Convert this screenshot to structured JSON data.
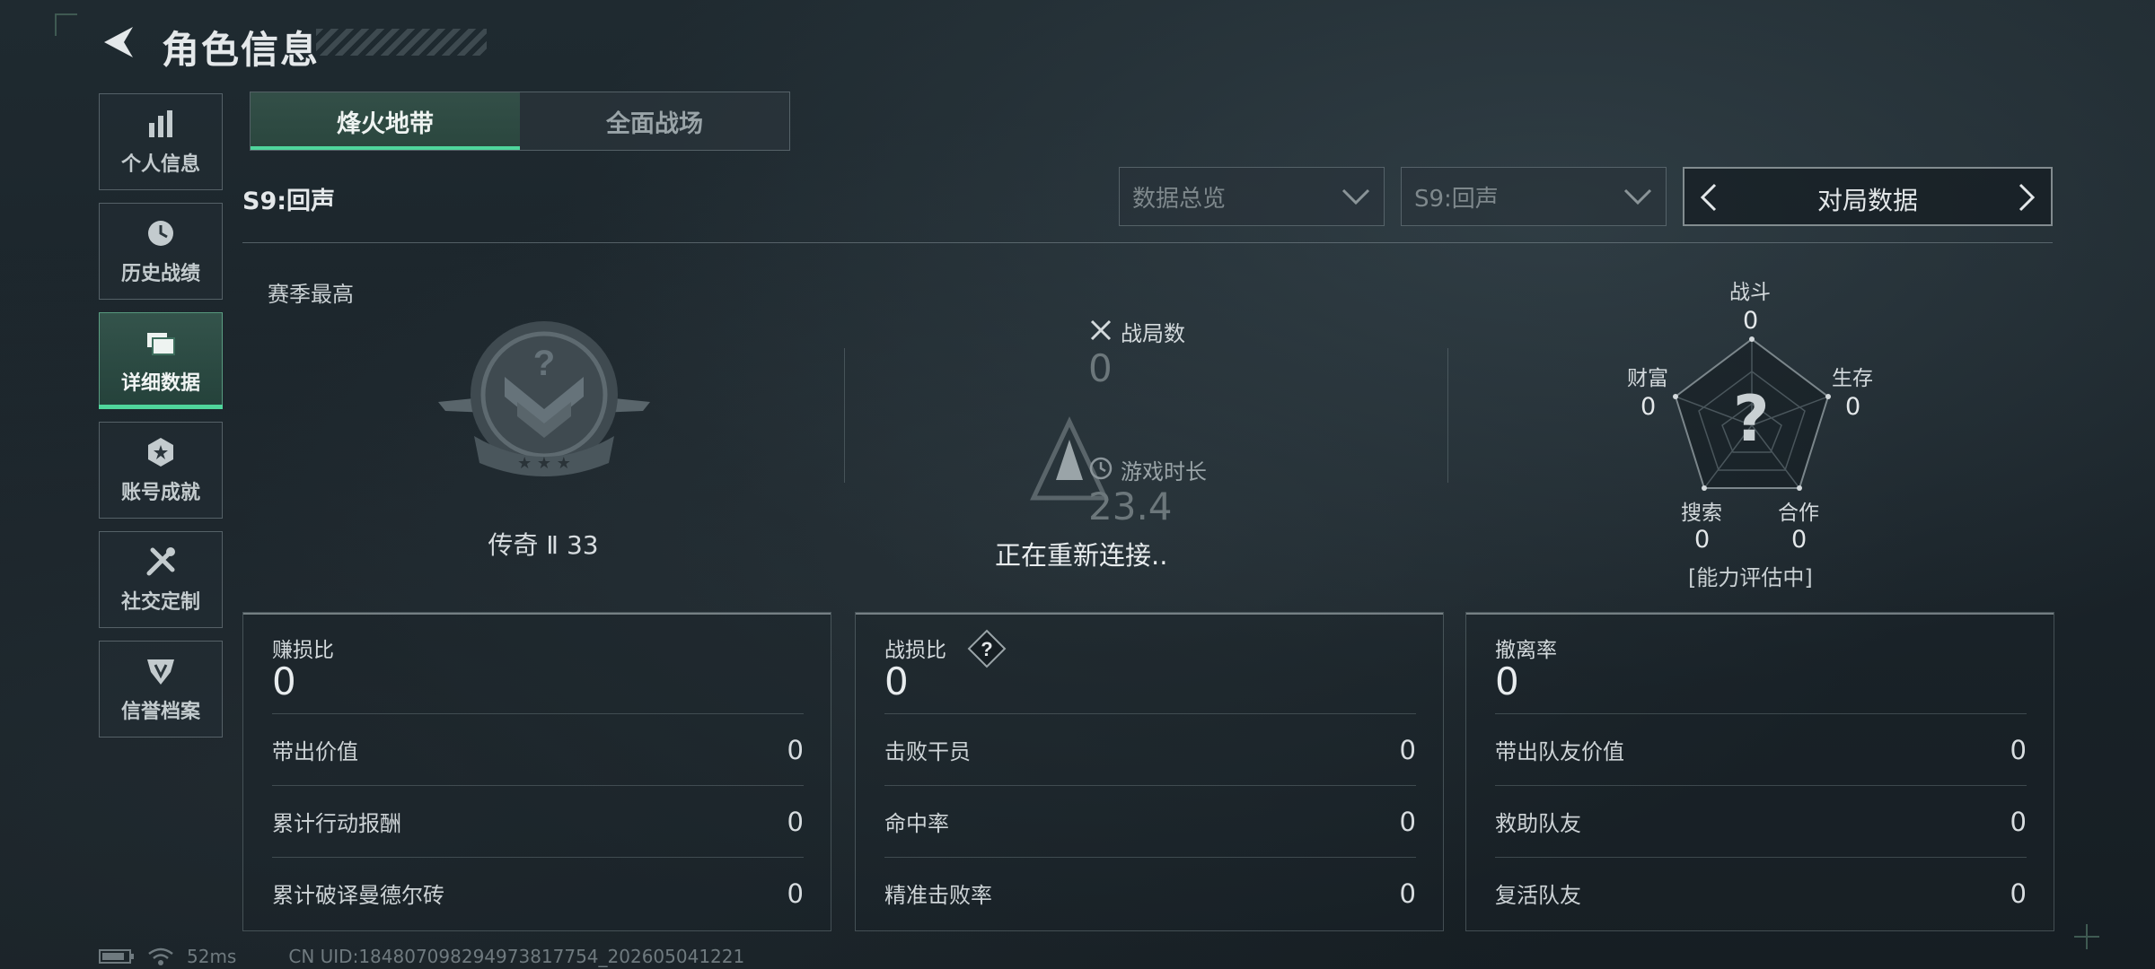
{
  "header": {
    "title": "角色信息"
  },
  "sidebar": {
    "items": [
      {
        "label": "个人信息",
        "icon": "bar-chart-icon"
      },
      {
        "label": "历史战绩",
        "icon": "history-clock-icon"
      },
      {
        "label": "详细数据",
        "icon": "folder-icon",
        "active": true
      },
      {
        "label": "账号成就",
        "icon": "achievement-icon"
      },
      {
        "label": "社交定制",
        "icon": "tools-icon"
      },
      {
        "label": "信誉档案",
        "icon": "reputation-icon"
      }
    ]
  },
  "tabs": [
    {
      "label": "烽火地带",
      "active": true
    },
    {
      "label": "全面战场",
      "active": false
    }
  ],
  "season": {
    "label": "S9:回声"
  },
  "filters": {
    "dropdown1": "数据总览",
    "dropdown2": "S9:回声",
    "switcher": "对局数据"
  },
  "rank": {
    "caption": "赛季最高",
    "name": "传奇 Ⅱ 33"
  },
  "match": {
    "games_label": "战局数",
    "games_value": "0",
    "time_label": "游戏时长",
    "time_value": "23.4",
    "reconnect": "正在重新连接.."
  },
  "radar": {
    "center": "?",
    "combat_label": "战斗",
    "combat_value": "0",
    "survival_label": "生存",
    "survival_value": "0",
    "coop_label": "合作",
    "coop_value": "0",
    "search_label": "搜索",
    "search_value": "0",
    "wealth_label": "财富",
    "wealth_value": "0",
    "note": "[能力评估中]"
  },
  "cards": [
    {
      "head_label": "赚损比",
      "head_value": "0",
      "rows": [
        {
          "label": "带出价值",
          "value": "0"
        },
        {
          "label": "累计行动报酬",
          "value": "0"
        },
        {
          "label": "累计破译曼德尔砖",
          "value": "0"
        }
      ]
    },
    {
      "head_label": "战损比",
      "head_value": "0",
      "help": "?",
      "rows": [
        {
          "label": "击败干员",
          "value": "0"
        },
        {
          "label": "命中率",
          "value": "0"
        },
        {
          "label": "精准击败率",
          "value": "0"
        }
      ]
    },
    {
      "head_label": "撤离率",
      "head_value": "0",
      "rows": [
        {
          "label": "带出队友价值",
          "value": "0"
        },
        {
          "label": "救助队友",
          "value": "0"
        },
        {
          "label": "复活队友",
          "value": "0"
        }
      ]
    }
  ],
  "footer": {
    "ping": "52ms",
    "uid": "CN UID:1848070982949738177​54_202605041221"
  },
  "colors": {
    "accent": "#4fd69c",
    "background": "#1c262c"
  }
}
